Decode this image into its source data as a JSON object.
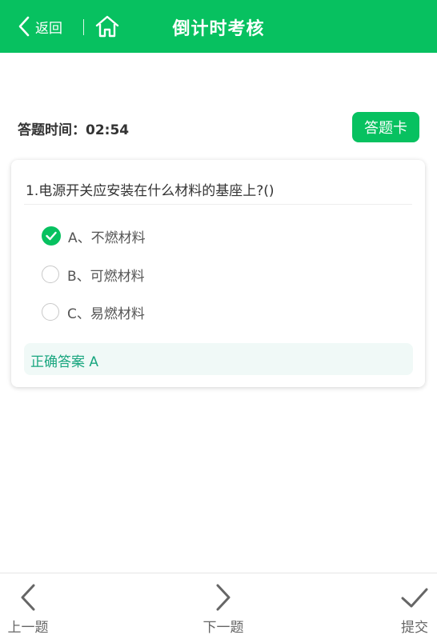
{
  "header": {
    "back_label": "返回",
    "title": "倒计时考核",
    "back_icon": "chevron-left-icon",
    "home_icon": "home-icon",
    "bg_color": "#07c160"
  },
  "timer": {
    "label": "答题时间：02:54"
  },
  "answer_card_button": "答题卡",
  "question": {
    "text": "1.电源开关应安装在什么材料的基座上?()",
    "options": [
      {
        "label": "A、不燃材料",
        "checked": true
      },
      {
        "label": "B、可燃材料",
        "checked": false
      },
      {
        "label": "C、易燃材料",
        "checked": false
      }
    ],
    "correct_answer": "正确答案 A"
  },
  "footer": {
    "prev_label": "上一题",
    "next_label": "下一题",
    "submit_label": "提交"
  },
  "colors": {
    "accent": "#07c160",
    "answer_text": "#19a67f",
    "answer_bg": "#f0f9f7"
  }
}
